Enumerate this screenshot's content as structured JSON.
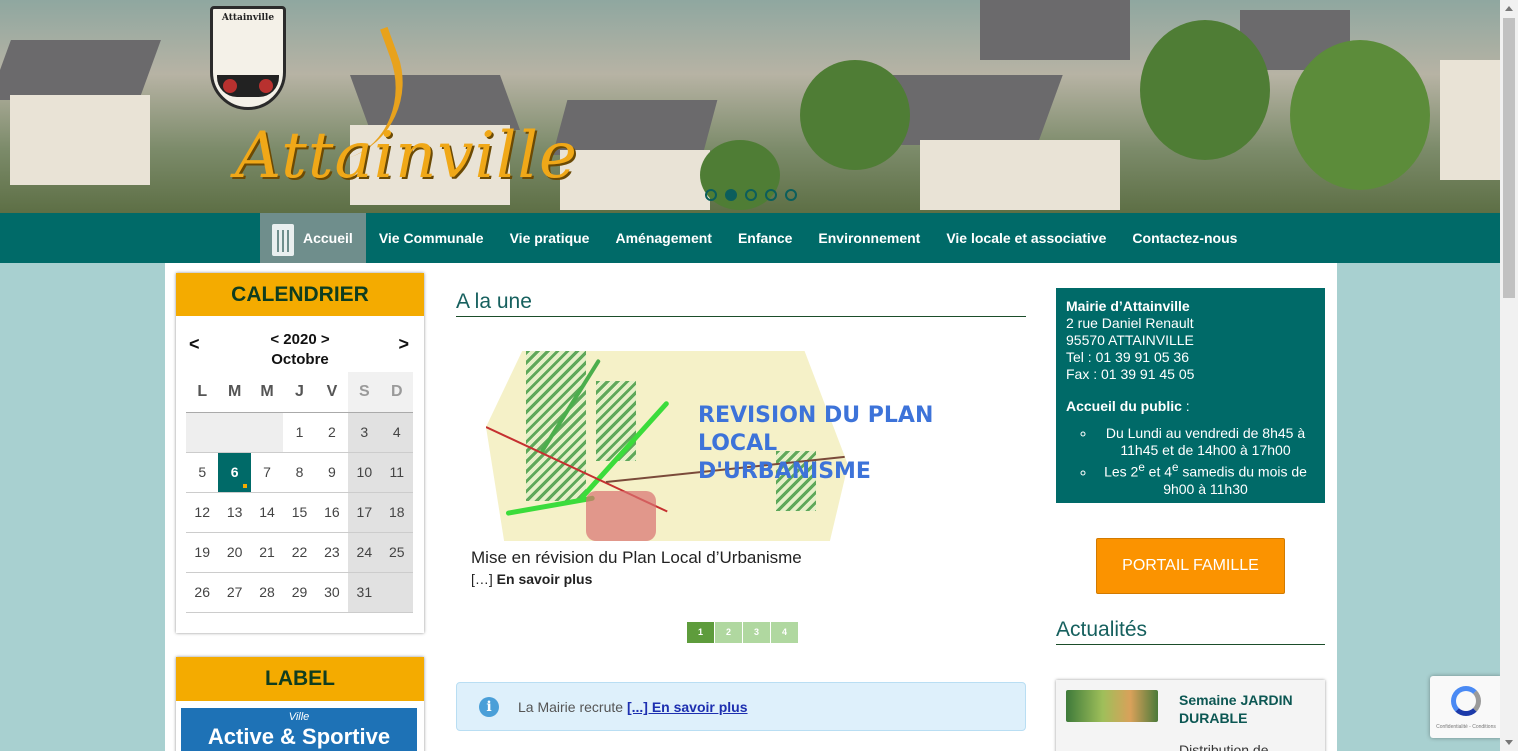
{
  "header": {
    "crest_title": "Attainville",
    "brand": "Attainville",
    "slider_dots": [
      false,
      true,
      false,
      false,
      false
    ]
  },
  "nav": {
    "items": [
      "Accueil",
      "Vie Communale",
      "Vie pratique",
      "Aménagement",
      "Enfance",
      "Environnement",
      "Vie locale et associative",
      "Contactez-nous"
    ]
  },
  "calendar": {
    "title": "CALENDRIER",
    "prev": "<",
    "next": ">",
    "year": "< 2020 >",
    "month": "Octobre",
    "weekdays": [
      "L",
      "M",
      "M",
      "J",
      "V",
      "S",
      "D"
    ],
    "weeks": [
      [
        "",
        "",
        "",
        "1",
        "2",
        "3",
        "4"
      ],
      [
        "5",
        "6",
        "7",
        "8",
        "9",
        "10",
        "11"
      ],
      [
        "12",
        "13",
        "14",
        "15",
        "16",
        "17",
        "18"
      ],
      [
        "19",
        "20",
        "21",
        "22",
        "23",
        "24",
        "25"
      ],
      [
        "26",
        "27",
        "28",
        "29",
        "30",
        "31",
        ""
      ]
    ],
    "today": "6"
  },
  "label": {
    "title": "LABEL",
    "badge_small": "Ville",
    "badge_big": "Active & Sportive"
  },
  "a_la_une": {
    "title": "A la une",
    "image_heading_line1": "REVISION DU PLAN LOCAL",
    "image_heading_line2": "D'URBANISME",
    "news_title": "Mise en révision du Plan Local d’Urbanisme",
    "news_ellipsis": "[…]",
    "news_more": "En savoir plus",
    "pages": [
      "1",
      "2",
      "3",
      "4"
    ],
    "active_page": "1"
  },
  "alert": {
    "icon": "info-icon",
    "text": "La Mairie recrute",
    "link": "[...] En savoir plus"
  },
  "mairie": {
    "name": "Mairie d’Attainville",
    "address1": "2 rue Daniel Renault",
    "address2": "95570 ATTAINVILLE",
    "tel": "Tel : 01 39 91 05 36",
    "fax": "Fax : 01 39 91 45 05",
    "accueil": "Accueil du public",
    "accueil_suffix": " :",
    "hours1": "Du Lundi au vendredi de 8h45 à 11h45 et de 14h00 à 17h00",
    "hours2_a": "Les 2",
    "hours2_sup1": "e",
    "hours2_b": " et 4",
    "hours2_sup2": "e",
    "hours2_c": " samedis du mois de 9h00 à 11h30"
  },
  "portail": {
    "label": "PORTAIL FAMILLE"
  },
  "actualites": {
    "title": "Actualités",
    "card_title": "Semaine JARDIN DURABLE",
    "card_desc": "Distribution de"
  },
  "recaptcha": {
    "text": "Confidentialité - Conditions"
  }
}
